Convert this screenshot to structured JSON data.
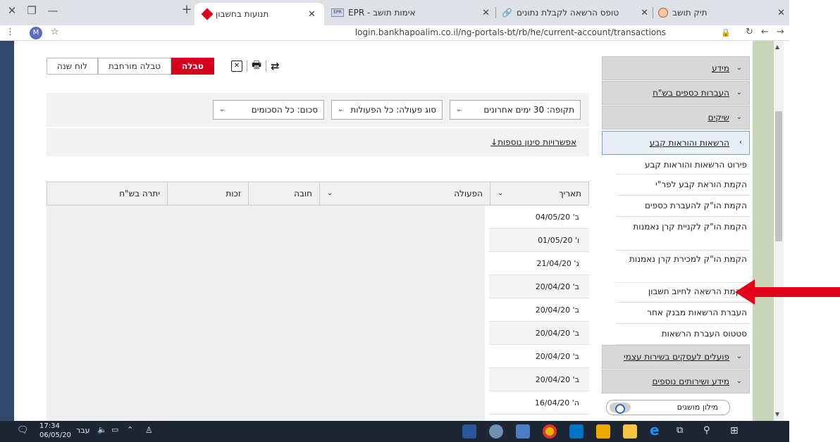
{
  "browser": {
    "tabs": [
      {
        "title": "תיק תושב",
        "icon": "heart-icon"
      },
      {
        "title": "טופס הרשאה לקבלת נתונים",
        "icon": "link-icon"
      },
      {
        "title": "אימות תושב - EPR",
        "icon": "epr-icon"
      },
      {
        "title": "תנועות בחשבון",
        "icon": "bank-hapoalim-icon",
        "active": true
      }
    ],
    "new_tab": "+",
    "url": "login.bankhapoalim.co.il/ng-portals-bt/rb/he/current-account/transactions",
    "profile_initial": "M"
  },
  "toolbar": {
    "view_table": "טבלה",
    "view_extended": "טבלה מורחבת",
    "view_calendar": "לוח שנה"
  },
  "filters": {
    "period": "תקופה: 30 ימים אחרונים",
    "action_type": "סוג פעולה: כל הפעולות",
    "amount": "סכום: כל הסכומים",
    "advanced": "אפשרויות סינון נוספות"
  },
  "table": {
    "columns": {
      "date": "תאריך",
      "action": "הפעולה",
      "debit": "חובה",
      "credit": "זכות",
      "balance": "יתרה בש\"ח"
    },
    "rows": [
      "ב' 04/05/20",
      "ו' 01/05/20",
      "ג' 21/04/20",
      "ב' 20/04/20",
      "ב' 20/04/20",
      "ב' 20/04/20",
      "ב' 20/04/20",
      "ב' 20/04/20",
      "ה' 16/04/20"
    ]
  },
  "sidebar": {
    "sections": [
      {
        "label": "מידע"
      },
      {
        "label": "העברות כספים בש\"ח"
      },
      {
        "label": "שיקים"
      },
      {
        "label": "הרשאות והוראות קבע",
        "open": true
      }
    ],
    "items": [
      "פירוט הרשאות והוראות קבע",
      "הקמת הוראת קבע לפר\"י",
      "הקמת הו\"ק להעברת כספים",
      "הקמת הו\"ק לקניית קרן נאמנות",
      "הקמת הו\"ק למכירת קרן נאמנות",
      "הקמת הרשאה לחיוב חשבון",
      "העברת הרשאות מבנק אחר",
      "סטטוס העברת הרשאות"
    ],
    "bottom_sections": [
      {
        "label": "פועלים לעסקים בשירות עצמי"
      },
      {
        "label": "מידע ושירותים נוספים"
      }
    ],
    "glossary_toggle": "מילון מושגים"
  },
  "taskbar": {
    "time": "17:34",
    "date": "06/05/20",
    "lang": "עבר"
  },
  "colors": {
    "accent": "#d4001d",
    "arrow": "#e3001b",
    "left_strip": "#33466b"
  }
}
